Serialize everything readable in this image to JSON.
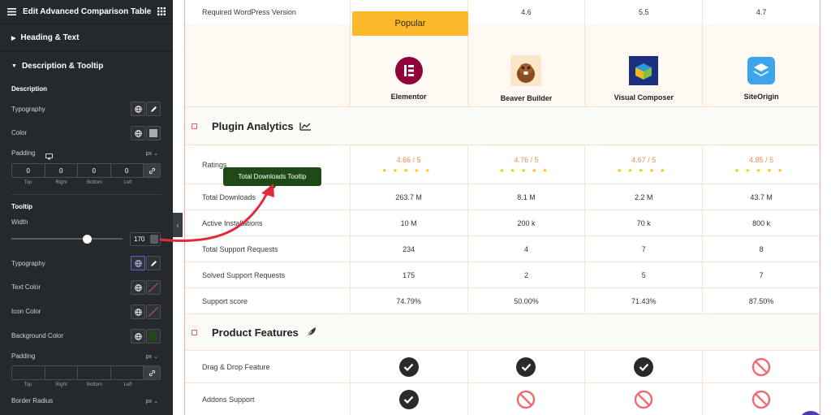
{
  "panel": {
    "title": "Edit Advanced Comparison Table",
    "sections": {
      "heading": "Heading & Text",
      "description": "Description & Tooltip"
    },
    "description": {
      "label": "Description",
      "typography": "Typography",
      "color": "Color",
      "padding": "Padding",
      "padding_unit": "px",
      "padding_values": [
        "0",
        "0",
        "0",
        "0"
      ],
      "padding_labels": [
        "Top",
        "Right",
        "Bottom",
        "Left"
      ]
    },
    "tooltip": {
      "label": "Tooltip",
      "width_label": "Width",
      "width_value": "170",
      "typography": "Typography",
      "text_color": "Text Color",
      "icon_color": "Icon Color",
      "background_color": "Background Color",
      "padding": "Padding",
      "padding_unit": "px",
      "padding_labels": [
        "Top",
        "Right",
        "Bottom",
        "Left"
      ],
      "border_radius": "Border Radius",
      "border_radius_unit": "px"
    }
  },
  "table": {
    "popular_badge": "Popular",
    "wp_row": {
      "label": "Required WordPress Version",
      "values": [
        "",
        "4.6",
        "5.5",
        "4.7"
      ]
    },
    "plugins": [
      {
        "name": "Elementor",
        "icon": "elementor-logo"
      },
      {
        "name": "Beaver Builder",
        "icon": "beaver-logo"
      },
      {
        "name": "Visual Composer",
        "icon": "visual-composer-logo"
      },
      {
        "name": "SiteOrigin",
        "icon": "siteorigin-logo"
      }
    ],
    "analytics": {
      "title": "Plugin Analytics",
      "ratings_label": "Ratings",
      "ratings": [
        "4.66 / 5",
        "4.76 / 5",
        "4.67 / 5",
        "4.85 / 5"
      ],
      "rows": [
        {
          "label": "Total Downloads",
          "values": [
            "263.7 M",
            "8.1 M",
            "2.2 M",
            "43.7 M"
          ]
        },
        {
          "label": "Active Installations",
          "values": [
            "10 M",
            "200 k",
            "70 k",
            "800 k"
          ]
        },
        {
          "label": "Total Support Requests",
          "values": [
            "234",
            "4",
            "7",
            "8"
          ]
        },
        {
          "label": "Solved Support Requests",
          "values": [
            "175",
            "2",
            "5",
            "7"
          ]
        },
        {
          "label": "Support score",
          "values": [
            "74.79%",
            "50.00%",
            "71.43%",
            "87.50%"
          ]
        }
      ]
    },
    "features": {
      "title": "Product Features",
      "rows": [
        {
          "label": "Drag & Drop Feature",
          "values": [
            "yes",
            "yes",
            "yes",
            "no"
          ]
        },
        {
          "label": "Addons Support",
          "values": [
            "yes",
            "no",
            "no",
            "no"
          ]
        }
      ]
    },
    "tooltip_text": "Total Downloads Tooltip"
  },
  "colors": {
    "accent": "#fbb92c",
    "tooltip_bg": "#1f4a17",
    "rating": "#ef8a4c",
    "arrow": "#e02b3c"
  }
}
